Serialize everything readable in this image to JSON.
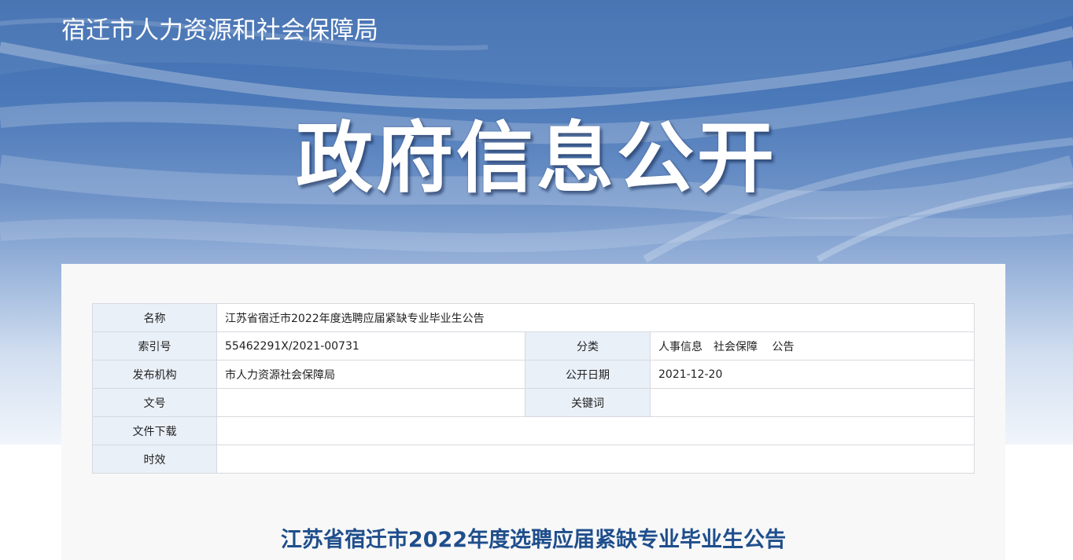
{
  "site": {
    "name": "宿迁市人力资源和社会保障局"
  },
  "banner": {
    "heading": "政府信息公开"
  },
  "meta": {
    "name_label": "名称",
    "name_value": "江苏省宿迁市2022年度选聘应届紧缺专业毕业生公告",
    "index_label": "索引号",
    "index_value": "55462291X/2021-00731",
    "category_label": "分类",
    "category_value": "人事信息　社会保障　 公告",
    "publisher_label": "发布机构",
    "publisher_value": "市人力资源社会保障局",
    "date_label": "公开日期",
    "date_value": "2021-12-20",
    "doc_no_label": "文号",
    "doc_no_value": "",
    "keywords_label": "关键词",
    "keywords_value": "",
    "download_label": "文件下载",
    "download_value": "",
    "validity_label": "时效",
    "validity_value": ""
  },
  "article": {
    "title": "江苏省宿迁市2022年度选聘应届紧缺专业毕业生公告"
  },
  "colors": {
    "banner_blue": "#3f6db0",
    "label_bg": "#eaf0f8",
    "title_blue": "#1f4e8c",
    "panel_bg": "#f8f8f8"
  }
}
